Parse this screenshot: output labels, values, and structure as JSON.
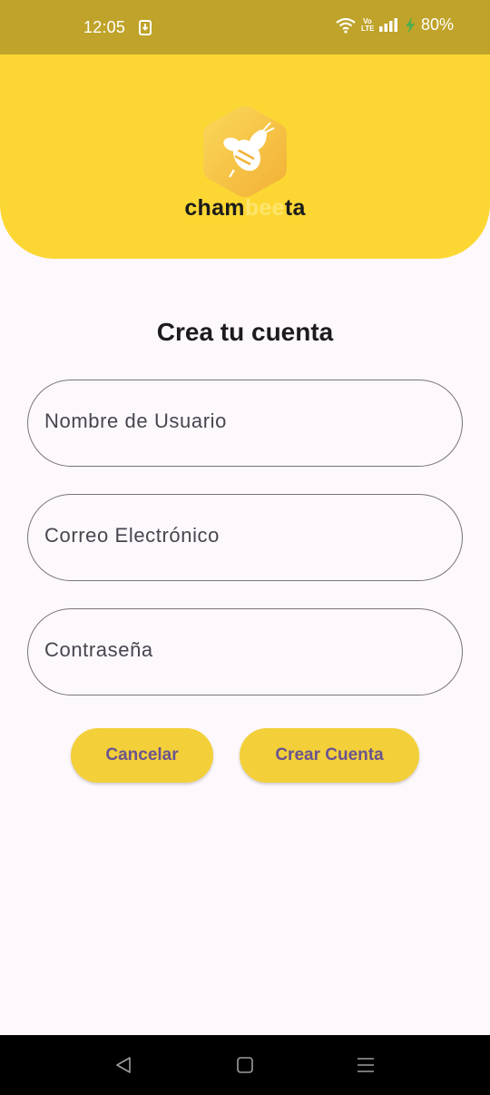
{
  "status_bar": {
    "time": "12:05",
    "battery": "80%",
    "volte_top": "Vo",
    "volte_bottom": "LTE",
    "icons": [
      "download-icon",
      "wifi-icon",
      "volte-icon",
      "signal-icon",
      "charging-icon"
    ]
  },
  "header": {
    "logo_icon": "bee-icon",
    "logo_text_start": "cham",
    "logo_text_faint": "bee",
    "logo_text_end": "ta",
    "colors": {
      "background": "#fcd734",
      "hexagon": "#f6bf3c"
    }
  },
  "form": {
    "title": "Crea tu cuenta",
    "username_label": "Nombre de Usuario",
    "email_label": "Correo Electrónico",
    "password_label": "Contraseña"
  },
  "buttons": {
    "cancel_label": "Cancelar",
    "create_label": "Crear Cuenta",
    "color": "#f3d03a",
    "text_color": "#6b548f"
  },
  "nav_bar": {
    "icons": [
      "back-icon",
      "home-icon",
      "recents-icon"
    ]
  }
}
